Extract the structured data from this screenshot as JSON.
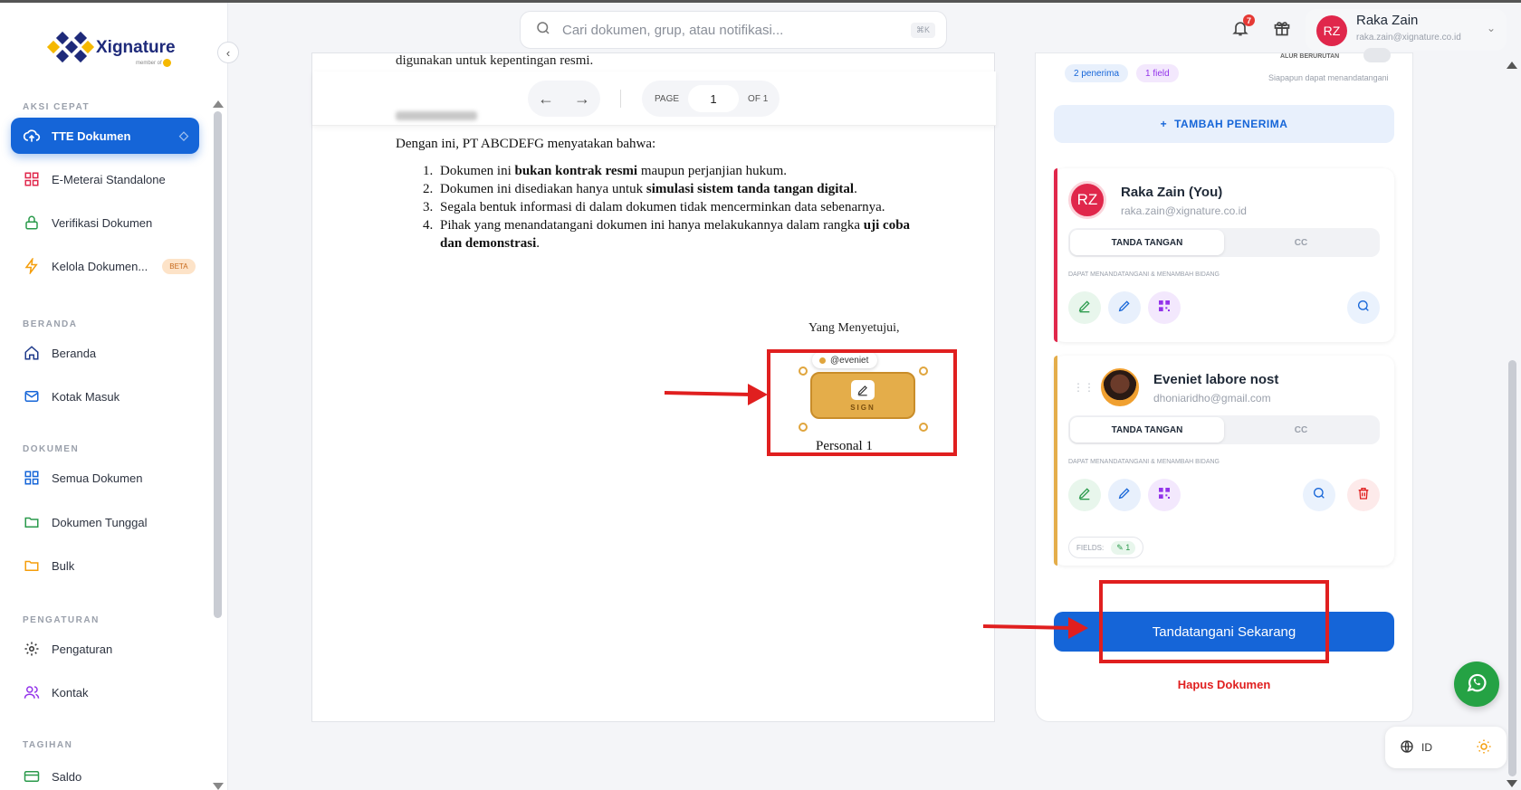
{
  "brand": {
    "name": "Xignature",
    "sub": "member of"
  },
  "sidebar": {
    "sections": {
      "aksi": "AKSI CEPAT",
      "beranda": "BERANDA",
      "dokumen": "DOKUMEN",
      "pengaturan": "PENGATURAN",
      "tagihan": "TAGIHAN"
    },
    "items": {
      "tte": "TTE Dokumen",
      "emeterai": "E-Meterai Standalone",
      "verifikasi": "Verifikasi Dokumen",
      "kelola": "Kelola Dokumen...",
      "kelola_badge": "BETA",
      "beranda": "Beranda",
      "kotak": "Kotak Masuk",
      "semua": "Semua Dokumen",
      "tunggal": "Dokumen Tunggal",
      "bulk": "Bulk",
      "pengaturan": "Pengaturan",
      "kontak": "Kontak",
      "saldo": "Saldo"
    }
  },
  "header": {
    "search_placeholder": "Cari dokumen, grup, atau notifikasi...",
    "shortcut": "⌘K",
    "notif_count": "7",
    "user": {
      "initials": "RZ",
      "name": "Raka Zain",
      "email": "raka.zain@xignature.co.id"
    }
  },
  "document": {
    "top_line": "digunakan untuk kepentingan resmi.",
    "pager": {
      "page_label": "PAGE",
      "page": "1",
      "of": "OF 1"
    },
    "intro": "Dengan ini, PT ABCDEFG menyatakan bahwa:",
    "items": [
      {
        "a": "Dokumen ini ",
        "b": "bukan kontrak resmi",
        "c": " maupun perjanjian hukum."
      },
      {
        "a": "Dokumen ini disediakan hanya untuk ",
        "b": "simulasi sistem tanda tangan digital",
        "c": "."
      },
      {
        "a": "Segala bentuk informasi di dalam dokumen tidak mencerminkan data sebenarnya.",
        "b": "",
        "c": ""
      },
      {
        "a": "Pihak yang menandatangani dokumen ini hanya melakukannya dalam rangka ",
        "b": "uji coba dan demonstrasi",
        "c": "."
      }
    ],
    "sign_above": "Yang Menyetujui,",
    "sign_tag": "@eveniet",
    "sign_label": "SIGN",
    "personal": "Personal 1"
  },
  "panel": {
    "chip_recipients": "2 penerima",
    "chip_fields": "1 field",
    "alur": "ALUR BERURUTAN",
    "anyone_can_sign": "Siapapun dapat menandatangani",
    "add_recipient": "TAMBAH PENERIMA",
    "recipients": [
      {
        "initials": "RZ",
        "name": "Raka Zain (You)",
        "email": "raka.zain@xignature.co.id",
        "opt_sign": "TANDA TANGAN",
        "opt_cc": "CC",
        "note": "DAPAT MENANDATANGANI & MENAMBAH BIDANG"
      },
      {
        "name": "Eveniet labore nost",
        "email": "dhoniaridho@gmail.com",
        "opt_sign": "TANDA TANGAN",
        "opt_cc": "CC",
        "note": "DAPAT MENANDATANGANI & MENAMBAH BIDANG",
        "fields_label": "FIELDS:",
        "fields_count": "1"
      }
    ],
    "sign_now": "Tandatangani Sekarang",
    "delete": "Hapus Dokumen"
  },
  "footer": {
    "lang": "ID"
  },
  "colors": {
    "primary": "#1565d8",
    "sign_field": "#e4ad4a",
    "annotation": "#e01f1f",
    "danger": "#e01f1f"
  }
}
